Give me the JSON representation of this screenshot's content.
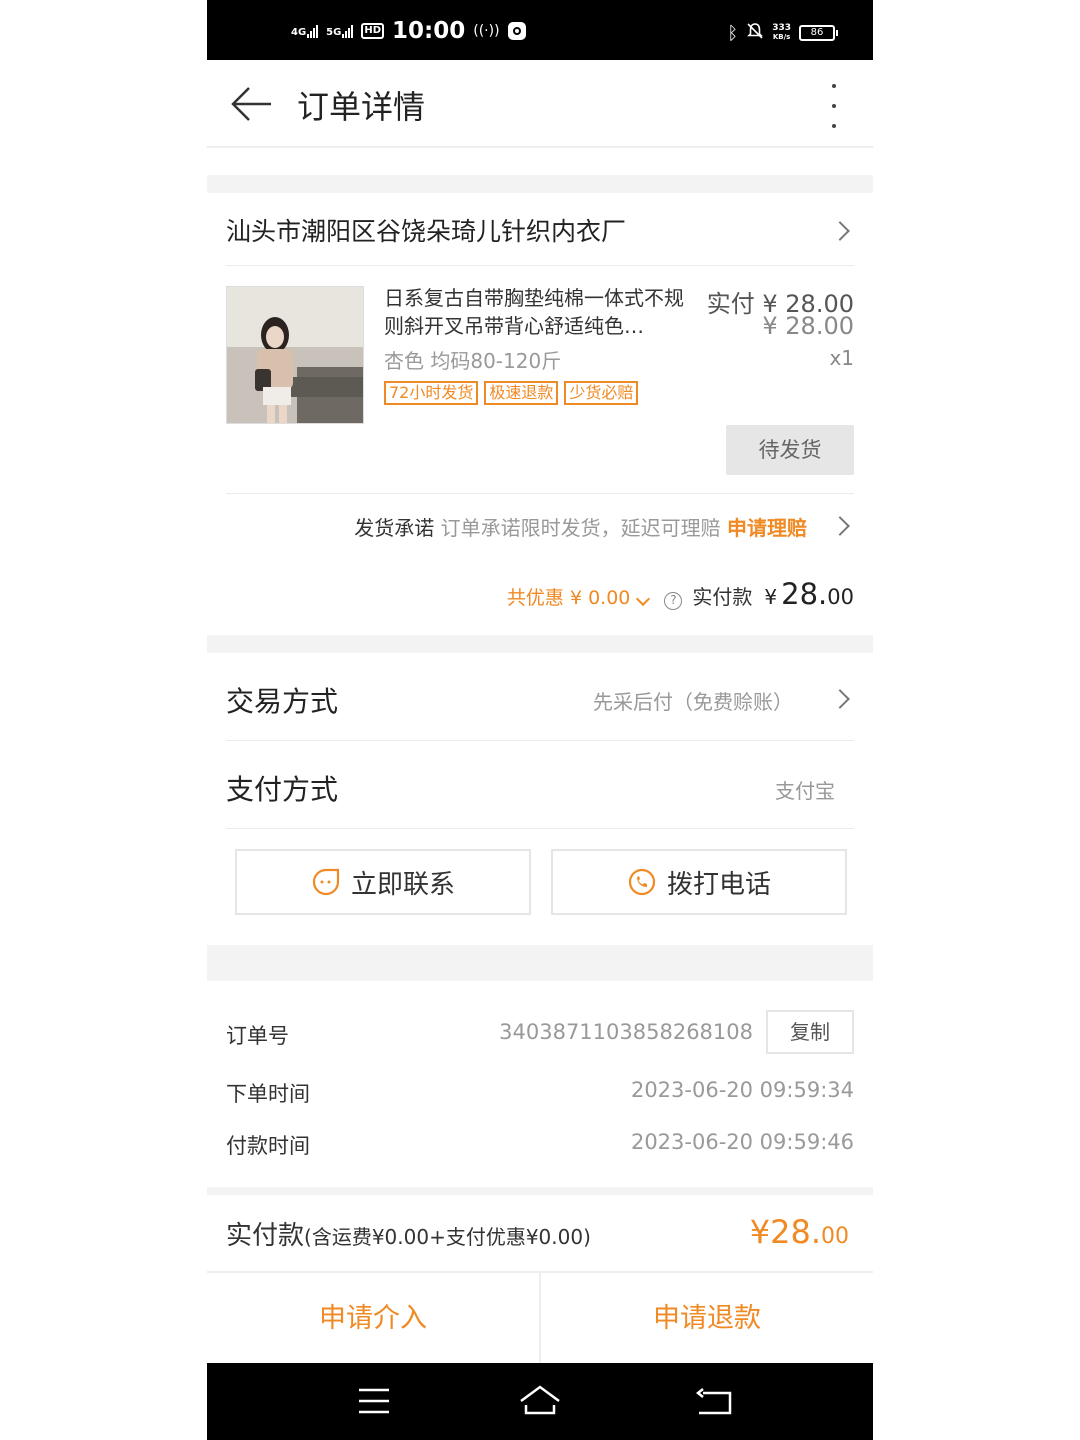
{
  "status_bar": {
    "net1": "4G",
    "net2": "5G",
    "hd": "HD",
    "time": "10:00",
    "speed": "333",
    "speed_unit": "KB/s",
    "battery": "86"
  },
  "header": {
    "title": "订单详情"
  },
  "shop": {
    "name": "汕头市潮阳区谷饶朵琦儿针织内衣厂"
  },
  "product": {
    "title": "日系复古自带胸垫纯棉一体式不规则斜开叉吊带背心舒适纯色…",
    "price_label": "实付 ¥ 28.00",
    "price_orig": "¥ 28.00",
    "qty": "x1",
    "variant": "杏色 均码80-120斤",
    "tags": [
      "72小时发货",
      "极速退款",
      "少货必赔"
    ],
    "status": "待发货"
  },
  "promise": {
    "label": "发货承诺",
    "text": "订单承诺限时发货，延迟可理赔",
    "link": "申请理赔"
  },
  "summary": {
    "discount": "共优惠 ¥ 0.00",
    "paid_label": "实付款",
    "currency": "¥",
    "amount_int": "28.",
    "amount_dec": "00"
  },
  "trade": {
    "label": "交易方式",
    "value": "先采后付（免费赊账）"
  },
  "payment": {
    "label": "支付方式",
    "value": "支付宝"
  },
  "actions": {
    "contact": "立即联系",
    "call": "拨打电话"
  },
  "order_info": {
    "order_no_label": "订单号",
    "order_no": "3403871103858268108",
    "copy": "复制",
    "placed_label": "下单时间",
    "placed": "2023-06-20 09:59:34",
    "paid_label": "付款时间",
    "paid": "2023-06-20 09:59:46"
  },
  "total": {
    "label": "实付款",
    "detail": "(含运费¥0.00+支付优惠¥0.00)",
    "amount_int": "¥28.",
    "amount_dec": "00"
  },
  "bottom": {
    "left": "申请介入",
    "right": "申请退款"
  },
  "colors": {
    "accent": "#f08a24",
    "background": "#ffffff",
    "divider": "#f3f3f3"
  }
}
